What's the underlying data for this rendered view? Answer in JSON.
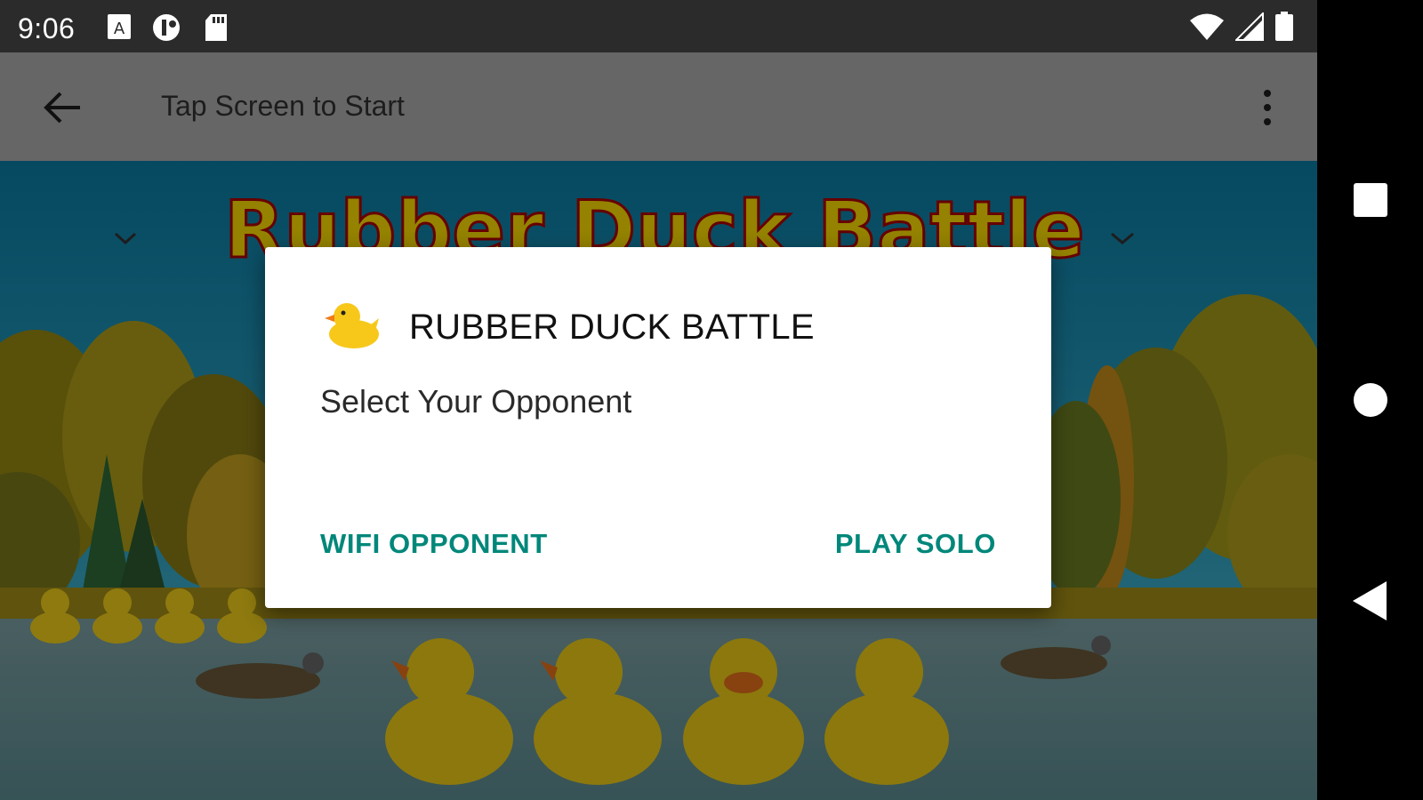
{
  "status_bar": {
    "time": "9:06",
    "left_icons": [
      "text-a-icon",
      "notification-badge-icon",
      "sd-card-icon"
    ],
    "right_icons": [
      "wifi-icon",
      "cell-signal-icon",
      "battery-icon"
    ]
  },
  "app_bar": {
    "title": "Tap Screen to Start",
    "back_icon": "arrow-back-icon",
    "overflow_icon": "more-vert-icon"
  },
  "game": {
    "title_text": "Rubber Duck  Battle"
  },
  "dialog": {
    "icon": "rubber-duck-icon",
    "title": "RUBBER DUCK BATTLE",
    "message": "Select Your Opponent",
    "buttons": {
      "wifi_label": "WIFI OPPONENT",
      "solo_label": "PLAY SOLO"
    },
    "accent_color": "#00877a"
  },
  "nav_bar": {
    "icons": [
      "recents-square-icon",
      "home-circle-icon",
      "back-triangle-icon"
    ]
  }
}
